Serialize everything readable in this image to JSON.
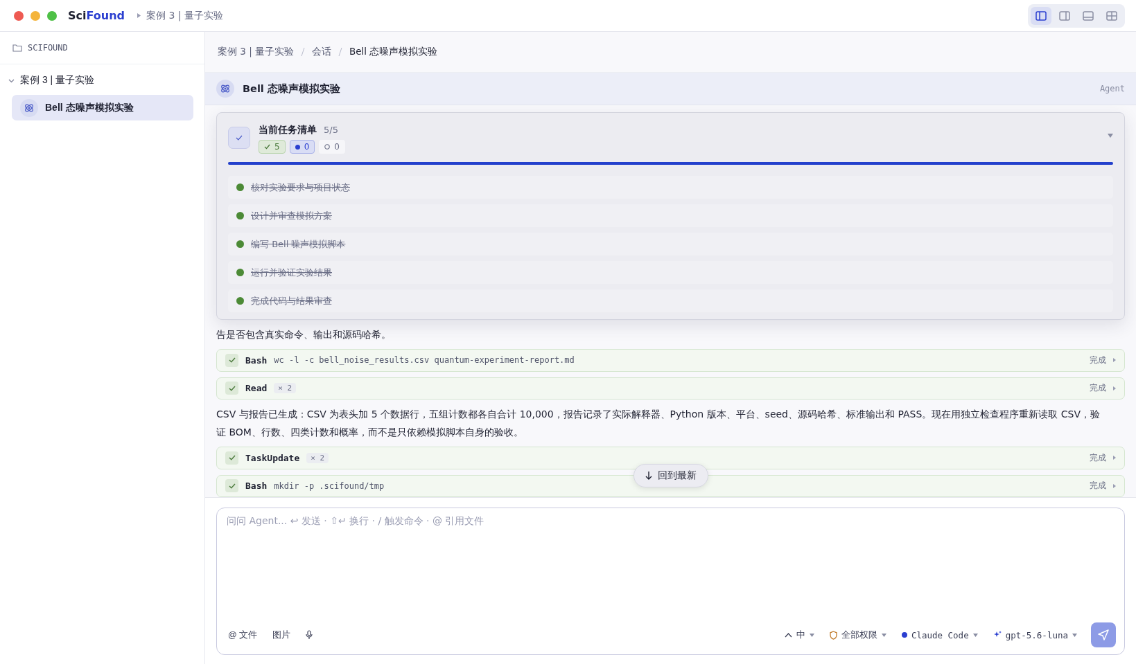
{
  "titlebar": {
    "brand_prefix": "Sci",
    "brand_accent": "Found",
    "path": "案例 3 | 量子实验",
    "layout_buttons": [
      {
        "kind": "left-panel",
        "selected": true
      },
      {
        "kind": "right-panel",
        "selected": false
      },
      {
        "kind": "bottom-panel",
        "selected": false
      },
      {
        "kind": "grid",
        "selected": false
      }
    ]
  },
  "sidebar": {
    "root": "SCIFOUND",
    "projects": [
      {
        "label": "案例 3 | 量子实验",
        "expanded": true,
        "children": [
          {
            "label": "Bell 态噪声模拟实验",
            "selected": true
          }
        ]
      }
    ]
  },
  "breadcrumb": [
    "案例 3 | 量子实验",
    "会话",
    "Bell 态噪声模拟实验"
  ],
  "session": {
    "title": "Bell 态噪声模拟实验",
    "mode": "Agent"
  },
  "task_panel": {
    "title": "当前任务清单",
    "count": "5/5",
    "expanded": true,
    "level": 1,
    "badges": [
      {
        "kind": "done",
        "text": "5"
      },
      {
        "kind": "active",
        "text": "0"
      },
      {
        "kind": "pending",
        "text": "0"
      }
    ],
    "tasks": [
      {
        "label": "核对实验要求与项目状态",
        "done": true
      },
      {
        "label": "设计并审查模拟方案",
        "done": true
      },
      {
        "label": "编写 Bell 噪声模拟脚本",
        "done": true
      },
      {
        "label": "运行并验证实验结果",
        "done": true
      },
      {
        "label": "完成代码与结果审查",
        "done": true
      }
    ]
  },
  "messages": [
    {
      "kind": "text",
      "text": "告是否包含真实命令、输出和源码哈希。"
    },
    {
      "kind": "tool",
      "name": "Bash",
      "detail": "wc -l -c bell_noise_results.csv quantum-experiment-report.md",
      "status": "完成"
    },
    {
      "kind": "tool",
      "name": "Read",
      "count": "× 2",
      "status": "完成"
    },
    {
      "kind": "text",
      "text": "CSV 与报告已生成：CSV 为表头加 5 个数据行，五组计数都各自合计 10,000，报告记录了实际解释器、Python 版本、平台、seed、源码哈希、标准输出和 PASS。现在用独立检查程序重新读取 CSV，验证 BOM、行数、四类计数和概率，而不是只依赖模拟脚本自身的验收。"
    },
    {
      "kind": "tool",
      "name": "TaskUpdate",
      "count": "× 2",
      "status": "完成"
    },
    {
      "kind": "tool",
      "name": "Bash",
      "detail": "mkdir -p .scifound/tmp",
      "status": "完成"
    }
  ],
  "jump_button": "回到最新",
  "composer": {
    "placeholder": "问问 Agent... ↩ 发送 · ⇧↵ 换行 · / 触发命令 · @ 引用文件",
    "left_tools": [
      {
        "kind": "file",
        "label": "@ 文件"
      },
      {
        "kind": "image",
        "label": "图片"
      },
      {
        "kind": "mic"
      }
    ],
    "right_tools": [
      {
        "kind": "effort",
        "label": "中"
      },
      {
        "kind": "permission",
        "label": "全部权限"
      },
      {
        "kind": "agent",
        "label": "Claude Code"
      },
      {
        "kind": "model",
        "label": "gpt-5.6-luna"
      }
    ]
  }
}
